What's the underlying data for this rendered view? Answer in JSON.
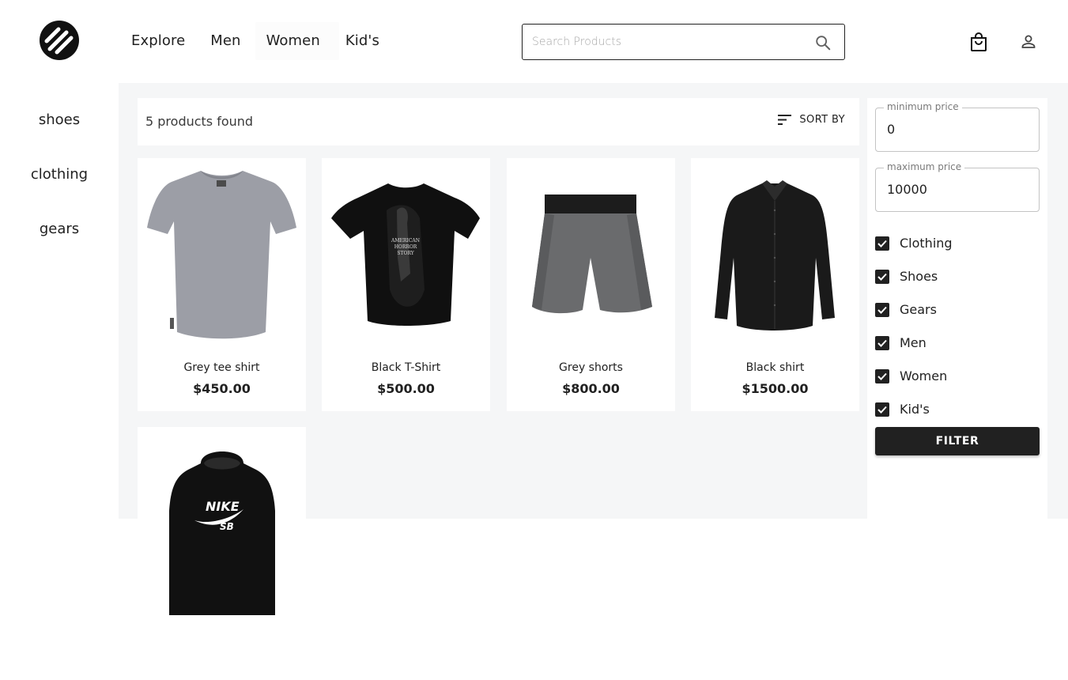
{
  "brand": {
    "logo_icon": "brand-logo-icon"
  },
  "nav": {
    "items": [
      {
        "label": "Explore"
      },
      {
        "label": "Men"
      },
      {
        "label": "Women"
      },
      {
        "label": "Kid's"
      }
    ]
  },
  "search": {
    "placeholder": "Search Products",
    "value": "",
    "icon": "search-icon"
  },
  "header_icons": {
    "cart": "shopping-bag-icon",
    "account": "user-icon"
  },
  "sidebar": {
    "categories": [
      {
        "label": "shoes"
      },
      {
        "label": "clothing"
      },
      {
        "label": "gears"
      }
    ]
  },
  "results": {
    "count_text": "5 products found",
    "sort_label": "SORT BY",
    "sort_icon": "sort-icon"
  },
  "products": [
    {
      "name": "Grey tee shirt",
      "price": "$450.00"
    },
    {
      "name": "Black T-Shirt",
      "price": "$500.00"
    },
    {
      "name": "Grey shorts",
      "price": "$800.00"
    },
    {
      "name": "Black shirt",
      "price": "$1500.00"
    },
    {
      "name": "",
      "price": ""
    }
  ],
  "filters": {
    "min_price": {
      "label": "minimum price",
      "value": "0"
    },
    "max_price": {
      "label": "maximum price",
      "value": "10000"
    },
    "checkboxes": [
      {
        "label": "Clothing",
        "checked": true
      },
      {
        "label": "Shoes",
        "checked": true
      },
      {
        "label": "Gears",
        "checked": true
      },
      {
        "label": "Men",
        "checked": true
      },
      {
        "label": "Women",
        "checked": true
      },
      {
        "label": "Kid's",
        "checked": true
      }
    ],
    "button_label": "FILTER"
  },
  "colors": {
    "accent": "#212121",
    "page_bg": "#f5f6f7",
    "card_bg": "#ffffff",
    "border": "#c4c4c4"
  }
}
